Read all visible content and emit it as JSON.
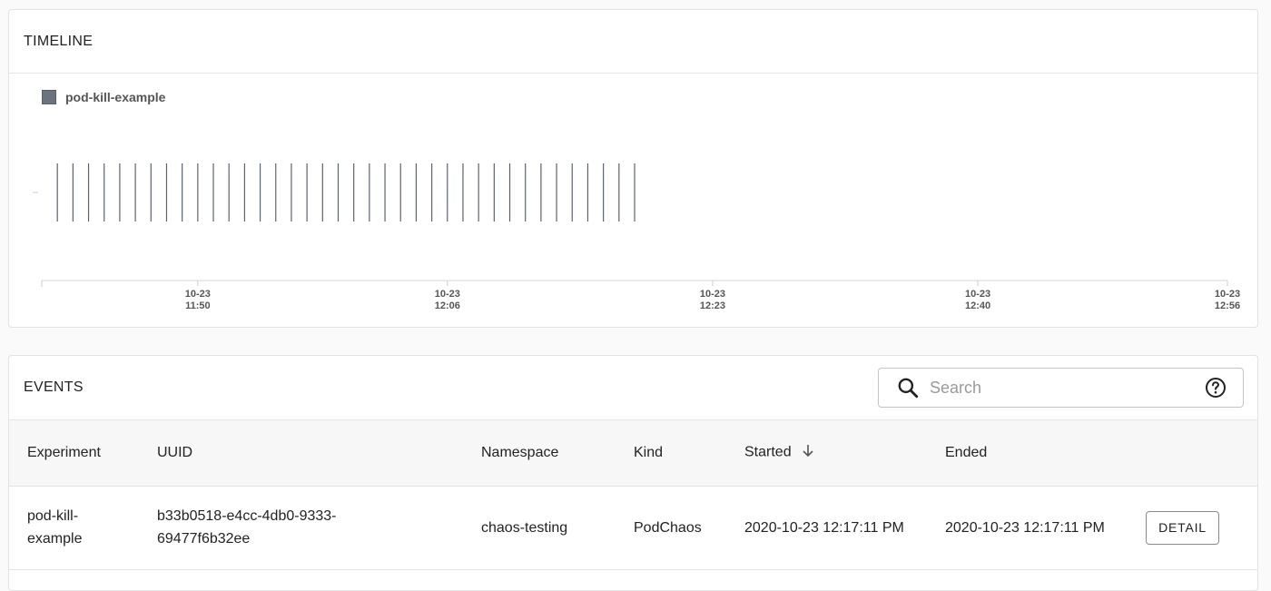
{
  "timeline": {
    "title": "TIMELINE",
    "legend_label": "pod-kill-example",
    "legend_color": "#6c7380"
  },
  "chart_data": {
    "type": "timeline",
    "series": [
      {
        "name": "pod-kill-example",
        "event_times": [
          "11:41",
          "11:42",
          "11:43",
          "11:44",
          "11:45",
          "11:46",
          "11:47",
          "11:48",
          "11:49",
          "11:50",
          "11:51",
          "11:52",
          "11:53",
          "11:54",
          "11:55",
          "11:56",
          "11:57",
          "11:58",
          "11:59",
          "12:00",
          "12:01",
          "12:02",
          "12:03",
          "12:04",
          "12:05",
          "12:06",
          "12:07",
          "12:08",
          "12:09",
          "12:10",
          "12:11",
          "12:12",
          "12:13",
          "12:14",
          "12:15",
          "12:16",
          "12:17",
          "12:18"
        ]
      }
    ],
    "x_range": [
      "11:40",
      "12:56"
    ],
    "x_ticks": [
      {
        "date": "10-23",
        "time": "11:50"
      },
      {
        "date": "10-23",
        "time": "12:06"
      },
      {
        "date": "10-23",
        "time": "12:23"
      },
      {
        "date": "10-23",
        "time": "12:40"
      },
      {
        "date": "10-23",
        "time": "12:56"
      }
    ],
    "color": "#5b6270"
  },
  "events": {
    "title": "EVENTS",
    "search": {
      "placeholder": "Search",
      "value": ""
    },
    "columns": [
      "Experiment",
      "UUID",
      "Namespace",
      "Kind",
      "Started",
      "Ended"
    ],
    "sorted_column": "Started",
    "rows": [
      {
        "experiment": "pod-kill-example",
        "uuid": "b33b0518-e4cc-4db0-9333-69477f6b32ee",
        "namespace": "chaos-testing",
        "kind": "PodChaos",
        "started": "2020-10-23 12:17:11 PM",
        "ended": "2020-10-23 12:17:11 PM",
        "action_label": "DETAIL"
      }
    ]
  }
}
